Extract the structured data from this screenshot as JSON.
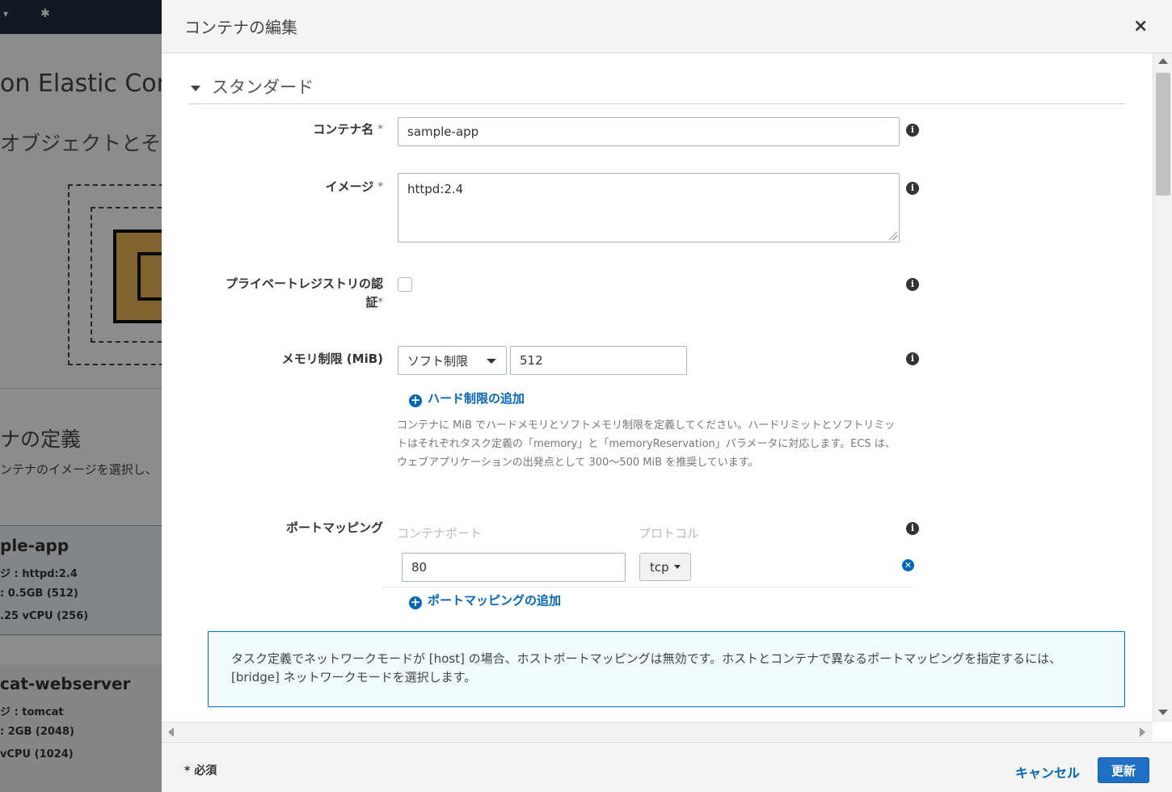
{
  "background": {
    "title_fragment": "on Elastic Con",
    "subtitle_fragment": "オブジェクトとそれ",
    "definition_heading": "ナの定義",
    "definition_sub": "ンテナのイメージを選択し、",
    "cards": [
      {
        "name": "ple-app",
        "lines": [
          "ジ : httpd:2.4",
          ": 0.5GB (512)",
          ".25 vCPU (256)"
        ]
      },
      {
        "name": "cat-webserver",
        "lines": [
          "ジ : tomcat",
          ": 2GB (2048)",
          "vCPU (1024)"
        ]
      }
    ]
  },
  "modal": {
    "title": "コンテナの編集",
    "close_label": "×",
    "section": "スタンダード",
    "fields": {
      "container_name": {
        "label": "コンテナ名",
        "required": "*",
        "value": "sample-app"
      },
      "image": {
        "label": "イメージ",
        "required": "*",
        "value": "httpd:2.4"
      },
      "private_registry": {
        "label_line1": "プライベートレジストリの認",
        "label_line2": "証",
        "required": "*"
      },
      "memory": {
        "label": "メモリ制限 (MiB)",
        "limit_type": "ソフト制限",
        "value": "512",
        "add_link": "ハード制限の追加",
        "help": "コンテナに MiB でハードメモリとソフトメモリ制限を定義してください。ハードリミットとソフトリミットはそれぞれタスク定義の「memory」と「memoryReservation」パラメータに対応します。ECS は、ウェブアプリケーションの出発点として 300～500 MiB を推奨しています。"
      },
      "port_mapping": {
        "label": "ポートマッピング",
        "col_container_port": "コンテナポート",
        "col_protocol": "プロトコル",
        "rows": [
          {
            "port": "80",
            "protocol": "tcp"
          }
        ],
        "add_link": "ポートマッピングの追加"
      }
    },
    "notice": "タスク定義でネットワークモードが [host] の場合、ホストポートマッピングは無効です。ホストとコンテナで異なるポートマッピングを指定するには、[bridge] ネットワークモードを選択します。",
    "footer": {
      "required_note": "* 必須",
      "cancel": "キャンセル",
      "update": "更新"
    }
  },
  "icons": {
    "info": "info-icon",
    "plus": "plus-circle-icon",
    "remove": "remove-circle-icon",
    "caret": "caret-down-icon"
  },
  "colors": {
    "link": "#0066c0",
    "primary_button": "#1f6fc5",
    "notice_border": "#0073bb",
    "notice_bg": "#f1faff"
  }
}
